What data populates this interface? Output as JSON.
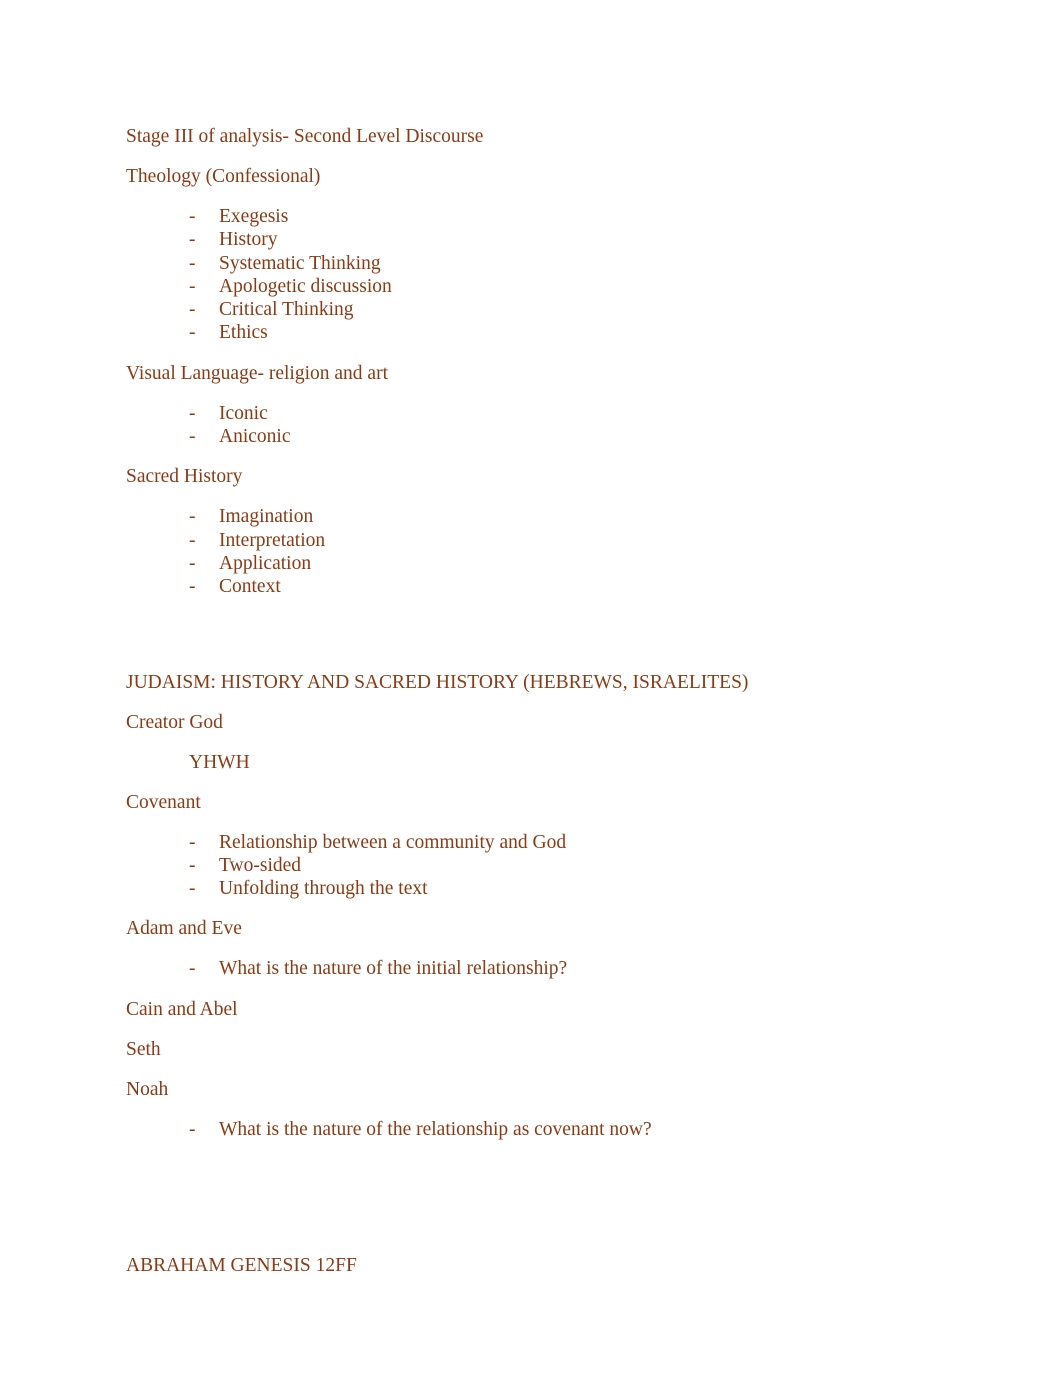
{
  "document": {
    "text_color": "#8c3a14",
    "background_color": "#ffffff",
    "blocks": [
      {
        "type": "para",
        "text": "Stage III of analysis- Second Level Discourse"
      },
      {
        "type": "para",
        "text": "Theology (Confessional)"
      },
      {
        "type": "bullets",
        "marker": "-",
        "items": [
          "Exegesis",
          "History",
          "Systematic Thinking",
          "Apologetic discussion",
          "Critical Thinking",
          "Ethics"
        ]
      },
      {
        "type": "para",
        "text": "Visual Language- religion and art"
      },
      {
        "type": "bullets",
        "marker": "-",
        "items": [
          "Iconic",
          "Aniconic"
        ]
      },
      {
        "type": "para",
        "text": "Sacred History"
      },
      {
        "type": "bullets",
        "marker": "-",
        "items": [
          "Imagination",
          "Interpretation",
          "Application",
          "Context"
        ]
      },
      {
        "type": "gap",
        "size": "gap-2"
      },
      {
        "type": "para",
        "text": "JUDAISM: HISTORY AND SACRED HISTORY (HEBREWS, ISRAELITES)"
      },
      {
        "type": "para",
        "text": "Creator God"
      },
      {
        "type": "indented",
        "text": "YHWH"
      },
      {
        "type": "para",
        "text": "Covenant"
      },
      {
        "type": "bullets",
        "marker": "-",
        "items": [
          "Relationship between a community and God",
          "Two-sided",
          "Unfolding through the text"
        ]
      },
      {
        "type": "para",
        "text": "Adam and Eve"
      },
      {
        "type": "bullets",
        "marker": "-",
        "items": [
          "What is the nature of the initial relationship?"
        ]
      },
      {
        "type": "para",
        "text": "Cain and Abel"
      },
      {
        "type": "para",
        "text": "Seth"
      },
      {
        "type": "para",
        "text": "Noah"
      },
      {
        "type": "bullets",
        "marker": "-",
        "items": [
          "What is the nature of the relationship as covenant now?"
        ]
      },
      {
        "type": "gap",
        "size": "gap-3"
      },
      {
        "type": "para",
        "text": "ABRAHAM GENESIS 12FF"
      }
    ]
  }
}
